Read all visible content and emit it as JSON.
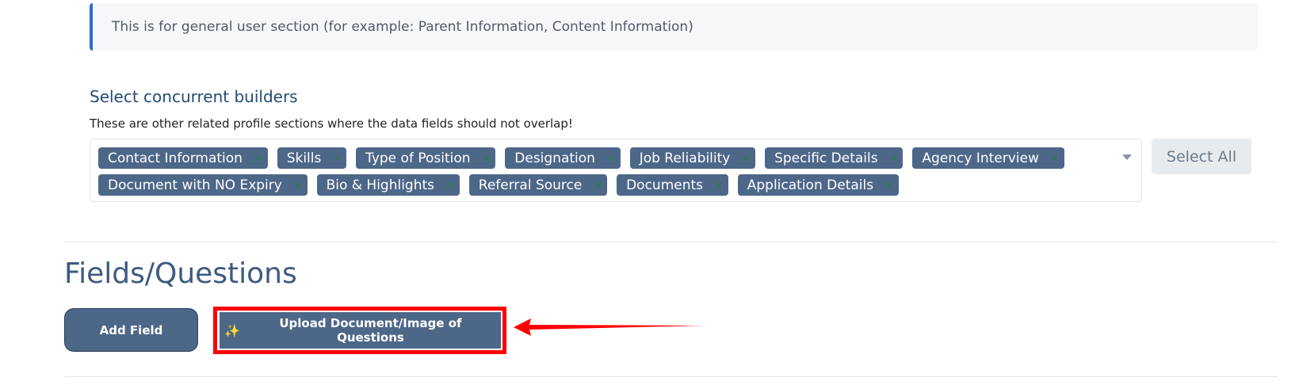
{
  "info": {
    "text": "This is for general user section (for example: Parent Information, Content Information)"
  },
  "builders": {
    "title": "Select concurrent builders",
    "description": "These are other related profile sections where the data fields should not overlap!",
    "tags": [
      "Contact Information",
      "Skills",
      "Type of Position",
      "Designation",
      "Job Reliability",
      "Specific Details",
      "Agency Interview",
      "Document with NO Expiry",
      "Bio & Highlights",
      "Referral Source",
      "Documents",
      "Application Details"
    ],
    "remove_symbol": "×",
    "select_all_label": "Select All"
  },
  "fields": {
    "title": "Fields/Questions",
    "add_field_label": "Add Field",
    "upload_label": "Upload Document/Image of Questions",
    "upload_icon": "sparkles-icon"
  },
  "colors": {
    "accent": "#4d6789",
    "info_border": "#2f6ad0",
    "highlight": "#ff0000"
  }
}
